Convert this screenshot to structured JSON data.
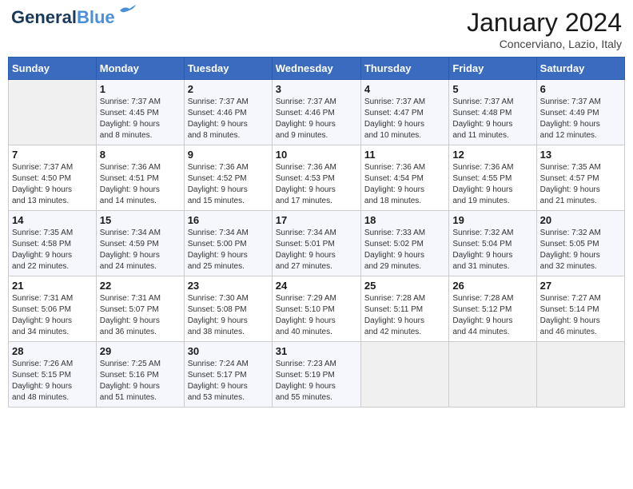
{
  "header": {
    "logo_line1": "General",
    "logo_line2": "Blue",
    "month": "January 2024",
    "location": "Concerviano, Lazio, Italy"
  },
  "days_of_week": [
    "Sunday",
    "Monday",
    "Tuesday",
    "Wednesday",
    "Thursday",
    "Friday",
    "Saturday"
  ],
  "weeks": [
    [
      {
        "num": "",
        "detail": ""
      },
      {
        "num": "1",
        "detail": "Sunrise: 7:37 AM\nSunset: 4:45 PM\nDaylight: 9 hours\nand 8 minutes."
      },
      {
        "num": "2",
        "detail": "Sunrise: 7:37 AM\nSunset: 4:46 PM\nDaylight: 9 hours\nand 8 minutes."
      },
      {
        "num": "3",
        "detail": "Sunrise: 7:37 AM\nSunset: 4:46 PM\nDaylight: 9 hours\nand 9 minutes."
      },
      {
        "num": "4",
        "detail": "Sunrise: 7:37 AM\nSunset: 4:47 PM\nDaylight: 9 hours\nand 10 minutes."
      },
      {
        "num": "5",
        "detail": "Sunrise: 7:37 AM\nSunset: 4:48 PM\nDaylight: 9 hours\nand 11 minutes."
      },
      {
        "num": "6",
        "detail": "Sunrise: 7:37 AM\nSunset: 4:49 PM\nDaylight: 9 hours\nand 12 minutes."
      }
    ],
    [
      {
        "num": "7",
        "detail": "Sunrise: 7:37 AM\nSunset: 4:50 PM\nDaylight: 9 hours\nand 13 minutes."
      },
      {
        "num": "8",
        "detail": "Sunrise: 7:36 AM\nSunset: 4:51 PM\nDaylight: 9 hours\nand 14 minutes."
      },
      {
        "num": "9",
        "detail": "Sunrise: 7:36 AM\nSunset: 4:52 PM\nDaylight: 9 hours\nand 15 minutes."
      },
      {
        "num": "10",
        "detail": "Sunrise: 7:36 AM\nSunset: 4:53 PM\nDaylight: 9 hours\nand 17 minutes."
      },
      {
        "num": "11",
        "detail": "Sunrise: 7:36 AM\nSunset: 4:54 PM\nDaylight: 9 hours\nand 18 minutes."
      },
      {
        "num": "12",
        "detail": "Sunrise: 7:36 AM\nSunset: 4:55 PM\nDaylight: 9 hours\nand 19 minutes."
      },
      {
        "num": "13",
        "detail": "Sunrise: 7:35 AM\nSunset: 4:57 PM\nDaylight: 9 hours\nand 21 minutes."
      }
    ],
    [
      {
        "num": "14",
        "detail": "Sunrise: 7:35 AM\nSunset: 4:58 PM\nDaylight: 9 hours\nand 22 minutes."
      },
      {
        "num": "15",
        "detail": "Sunrise: 7:34 AM\nSunset: 4:59 PM\nDaylight: 9 hours\nand 24 minutes."
      },
      {
        "num": "16",
        "detail": "Sunrise: 7:34 AM\nSunset: 5:00 PM\nDaylight: 9 hours\nand 25 minutes."
      },
      {
        "num": "17",
        "detail": "Sunrise: 7:34 AM\nSunset: 5:01 PM\nDaylight: 9 hours\nand 27 minutes."
      },
      {
        "num": "18",
        "detail": "Sunrise: 7:33 AM\nSunset: 5:02 PM\nDaylight: 9 hours\nand 29 minutes."
      },
      {
        "num": "19",
        "detail": "Sunrise: 7:32 AM\nSunset: 5:04 PM\nDaylight: 9 hours\nand 31 minutes."
      },
      {
        "num": "20",
        "detail": "Sunrise: 7:32 AM\nSunset: 5:05 PM\nDaylight: 9 hours\nand 32 minutes."
      }
    ],
    [
      {
        "num": "21",
        "detail": "Sunrise: 7:31 AM\nSunset: 5:06 PM\nDaylight: 9 hours\nand 34 minutes."
      },
      {
        "num": "22",
        "detail": "Sunrise: 7:31 AM\nSunset: 5:07 PM\nDaylight: 9 hours\nand 36 minutes."
      },
      {
        "num": "23",
        "detail": "Sunrise: 7:30 AM\nSunset: 5:08 PM\nDaylight: 9 hours\nand 38 minutes."
      },
      {
        "num": "24",
        "detail": "Sunrise: 7:29 AM\nSunset: 5:10 PM\nDaylight: 9 hours\nand 40 minutes."
      },
      {
        "num": "25",
        "detail": "Sunrise: 7:28 AM\nSunset: 5:11 PM\nDaylight: 9 hours\nand 42 minutes."
      },
      {
        "num": "26",
        "detail": "Sunrise: 7:28 AM\nSunset: 5:12 PM\nDaylight: 9 hours\nand 44 minutes."
      },
      {
        "num": "27",
        "detail": "Sunrise: 7:27 AM\nSunset: 5:14 PM\nDaylight: 9 hours\nand 46 minutes."
      }
    ],
    [
      {
        "num": "28",
        "detail": "Sunrise: 7:26 AM\nSunset: 5:15 PM\nDaylight: 9 hours\nand 48 minutes."
      },
      {
        "num": "29",
        "detail": "Sunrise: 7:25 AM\nSunset: 5:16 PM\nDaylight: 9 hours\nand 51 minutes."
      },
      {
        "num": "30",
        "detail": "Sunrise: 7:24 AM\nSunset: 5:17 PM\nDaylight: 9 hours\nand 53 minutes."
      },
      {
        "num": "31",
        "detail": "Sunrise: 7:23 AM\nSunset: 5:19 PM\nDaylight: 9 hours\nand 55 minutes."
      },
      {
        "num": "",
        "detail": ""
      },
      {
        "num": "",
        "detail": ""
      },
      {
        "num": "",
        "detail": ""
      }
    ]
  ]
}
